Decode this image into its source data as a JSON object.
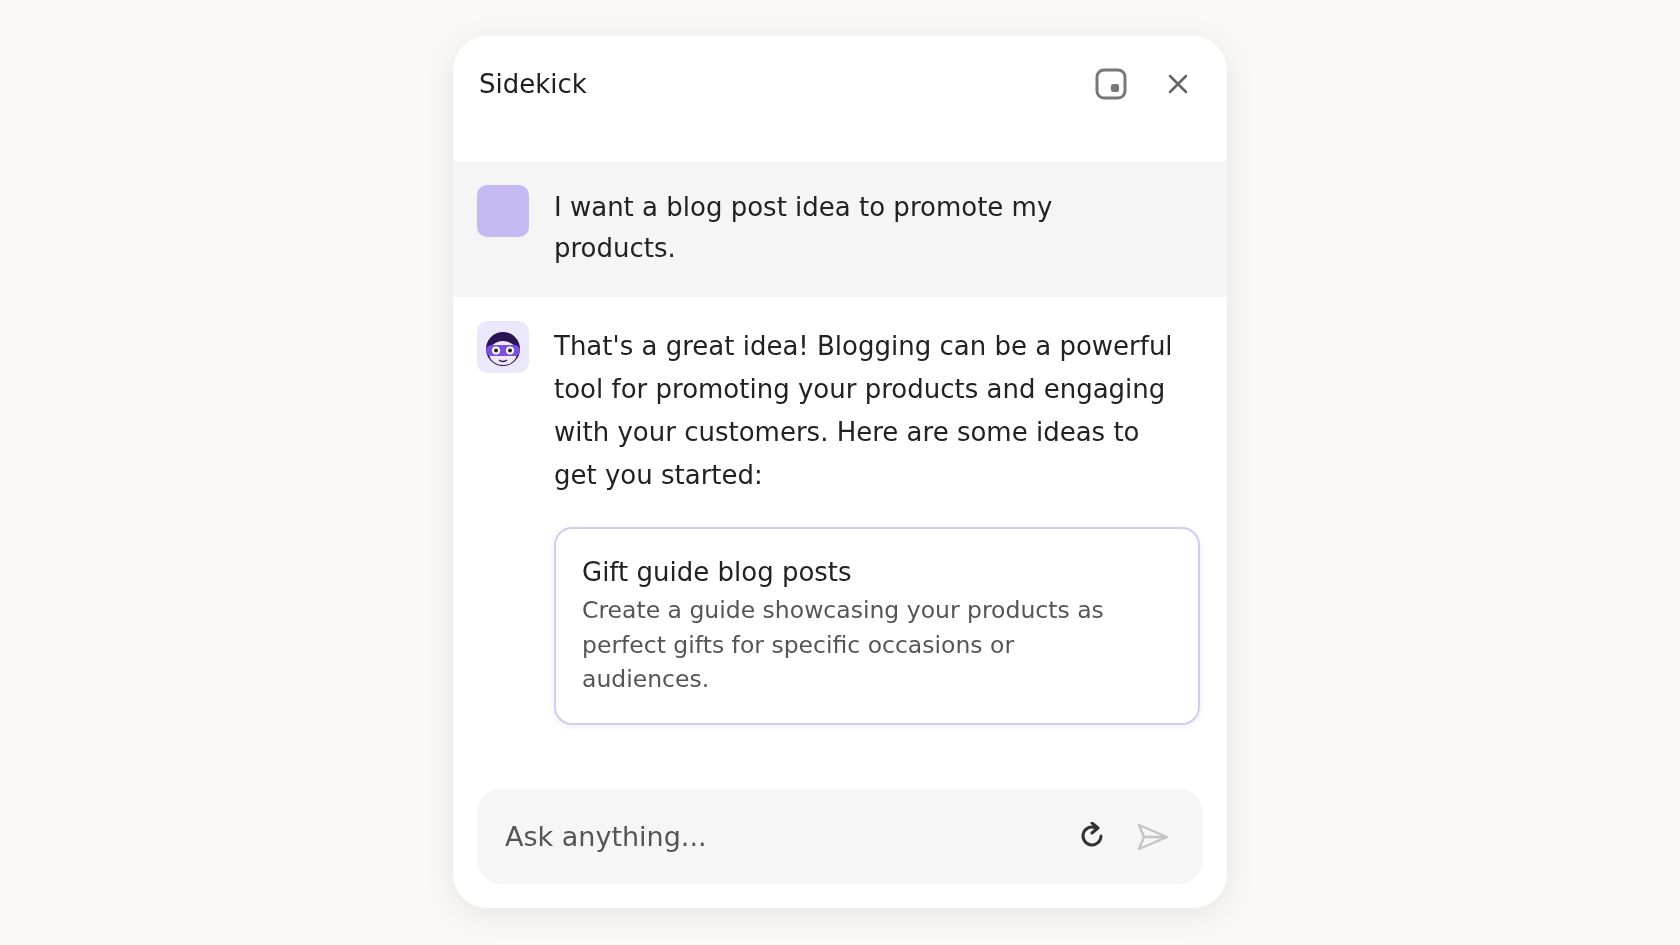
{
  "window": {
    "title": "Sidekick"
  },
  "messages": [
    {
      "kind": "user",
      "text": "I want a blog post idea to promote my products."
    },
    {
      "kind": "bot",
      "text": "That's a great idea! Blogging can be a powerful tool for promoting your products and engaging with your customers. Here are some ideas to get you started:",
      "cards": [
        {
          "title": "Gift guide blog posts",
          "body": "Create a guide showcasing your products as perfect gifts for specific occasions or audiences."
        }
      ]
    }
  ],
  "composer": {
    "placeholder": "Ask anything...",
    "send_disabled": true
  }
}
